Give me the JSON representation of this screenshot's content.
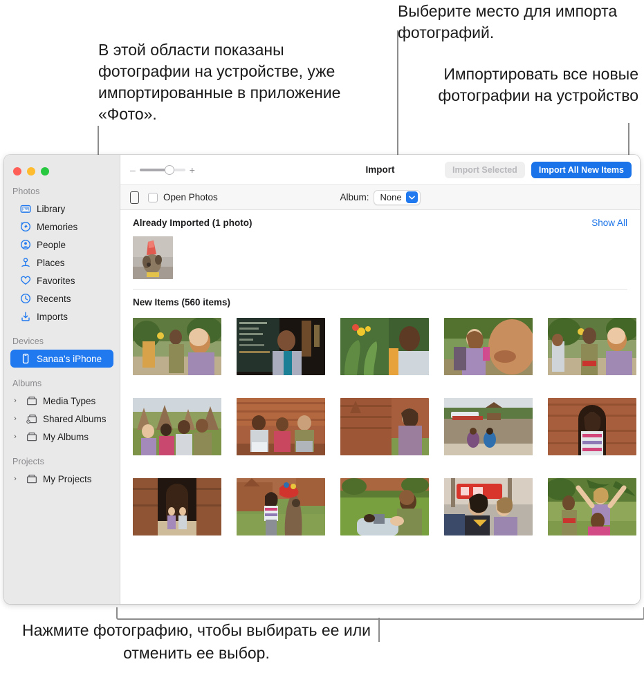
{
  "callouts": {
    "left": "В этой области показаны фотографии на устройстве, уже импортированные в приложение «Фото».",
    "album": "Выберите место для импорта фотографий.",
    "import_all": "Импортировать все новые фотографии на устройство",
    "bottom": "Нажмите фотографию, чтобы выбирать ее или отменить ее выбор."
  },
  "window": {
    "sidebar": {
      "groups": [
        {
          "title": "Photos",
          "items": [
            {
              "label": "Library",
              "icon": "library-icon",
              "selected": false,
              "disclosure": false
            },
            {
              "label": "Memories",
              "icon": "memories-icon",
              "selected": false,
              "disclosure": false
            },
            {
              "label": "People",
              "icon": "people-icon",
              "selected": false,
              "disclosure": false
            },
            {
              "label": "Places",
              "icon": "places-icon",
              "selected": false,
              "disclosure": false
            },
            {
              "label": "Favorites",
              "icon": "heart-icon",
              "selected": false,
              "disclosure": false
            },
            {
              "label": "Recents",
              "icon": "clock-icon",
              "selected": false,
              "disclosure": false
            },
            {
              "label": "Imports",
              "icon": "import-icon",
              "selected": false,
              "disclosure": false
            }
          ]
        },
        {
          "title": "Devices",
          "items": [
            {
              "label": "Sanaa's iPhone",
              "icon": "iphone-icon",
              "selected": true,
              "disclosure": false
            }
          ]
        },
        {
          "title": "Albums",
          "items": [
            {
              "label": "Media Types",
              "icon": "album-icon",
              "selected": false,
              "disclosure": true
            },
            {
              "label": "Shared Albums",
              "icon": "shared-album-icon",
              "selected": false,
              "disclosure": true
            },
            {
              "label": "My Albums",
              "icon": "album-icon",
              "selected": false,
              "disclosure": true
            }
          ]
        },
        {
          "title": "Projects",
          "items": [
            {
              "label": "My Projects",
              "icon": "album-icon",
              "selected": false,
              "disclosure": true
            }
          ]
        }
      ]
    },
    "toolbar": {
      "title": "Import",
      "zoom_minus": "–",
      "zoom_plus": "+",
      "import_selected_label": "Import Selected",
      "import_all_label": "Import All New Items"
    },
    "subbar": {
      "open_photos_label": "Open Photos",
      "album_label": "Album:",
      "album_value": "None",
      "album_options": [
        "None"
      ]
    },
    "content": {
      "already_imported_title": "Already Imported (1 photo)",
      "show_all_label": "Show All",
      "new_items_title": "New Items (560 items)",
      "imported_thumbs": [
        {
          "name": "dog-party-hat"
        }
      ],
      "new_thumbs": [
        {
          "name": "two-hikers-path"
        },
        {
          "name": "man-at-cafe-chalkboard"
        },
        {
          "name": "man-with-flowers"
        },
        {
          "name": "woman-backpack-closeup"
        },
        {
          "name": "couple-walking-path"
        },
        {
          "name": "group-at-temple"
        },
        {
          "name": "three-friends-brick-wall"
        },
        {
          "name": "woman-at-ruins"
        },
        {
          "name": "two-people-riverbank"
        },
        {
          "name": "woman-in-archway"
        },
        {
          "name": "couple-temple-corridor"
        },
        {
          "name": "woman-by-tree"
        },
        {
          "name": "couple-on-grass"
        },
        {
          "name": "two-women-in-tuktuk"
        },
        {
          "name": "friends-arms-raised"
        }
      ]
    }
  },
  "colors": {
    "accent": "#1a73e8",
    "selected_row": "#2079ef",
    "link": "#1a73e8",
    "sidebar_bg": "#e9e9e9",
    "callout_line": "#8c8c8c"
  }
}
